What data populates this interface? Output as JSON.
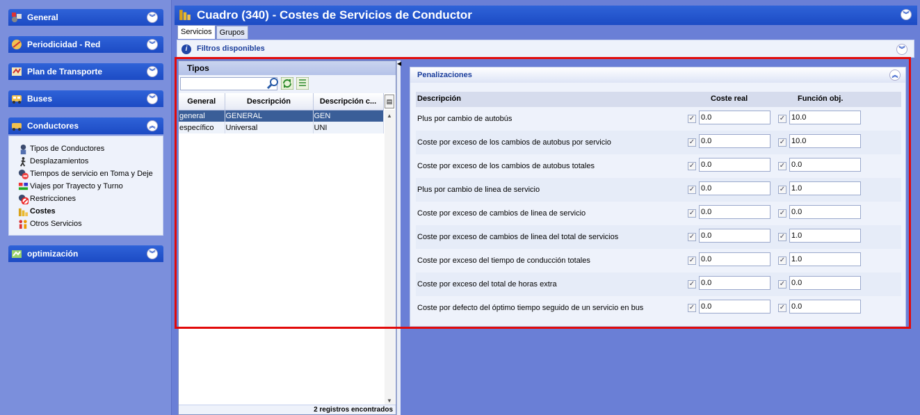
{
  "sidebar": {
    "sections": [
      {
        "label": "General",
        "icon": "general-icon",
        "expanded": false
      },
      {
        "label": "Periodicidad - Red",
        "icon": "periodicidad-icon",
        "expanded": false
      },
      {
        "label": "Plan de Transporte",
        "icon": "plan-icon",
        "expanded": false
      },
      {
        "label": "Buses",
        "icon": "bus-icon",
        "expanded": false
      },
      {
        "label": "Conductores",
        "icon": "conductores-icon",
        "expanded": true
      },
      {
        "label": "optimización",
        "icon": "optimizacion-icon",
        "expanded": false
      }
    ],
    "conductores_items": [
      {
        "label": "Tipos de Conductores",
        "icon": "driver-icon"
      },
      {
        "label": "Desplazamientos",
        "icon": "walk-icon"
      },
      {
        "label": "Tiempos de servicio en Toma y Deje",
        "icon": "clock-icon"
      },
      {
        "label": "Viajes por Trayecto y Turno",
        "icon": "trips-icon"
      },
      {
        "label": "Restricciones",
        "icon": "restriction-icon"
      },
      {
        "label": "Costes",
        "icon": "coins-icon",
        "active": true
      },
      {
        "label": "Otros Servicios",
        "icon": "people-icon"
      }
    ]
  },
  "header": {
    "title": "Cuadro (340) - Costes de Servicios de Conductor"
  },
  "tabs": [
    "Servicios",
    "Grupos"
  ],
  "filters": {
    "label": "Filtros disponibles"
  },
  "tipos": {
    "title": "Tipos",
    "search_value": "",
    "columns": [
      "General",
      "Descripción",
      "Descripción c..."
    ],
    "rows": [
      [
        "general",
        "GENERAL",
        "GEN"
      ],
      [
        "específico",
        "Universal",
        "UNI"
      ]
    ],
    "footer": "2 registros encontrados"
  },
  "penalizaciones": {
    "title": "Penalizaciones",
    "columns": {
      "descripcion": "Descripción",
      "coste_real": "Coste real",
      "funcion_obj": "Función obj."
    },
    "rows": [
      {
        "desc": "Plus por cambio de autobús",
        "coste_real": "0.0",
        "funcion_obj": "10.0"
      },
      {
        "desc": "Coste por exceso de los cambios de autobus por servicio",
        "coste_real": "0.0",
        "funcion_obj": "10.0"
      },
      {
        "desc": "Coste por exceso de los cambios de autobus totales",
        "coste_real": "0.0",
        "funcion_obj": "0.0"
      },
      {
        "desc": "Plus por cambio de linea de servicio",
        "coste_real": "0.0",
        "funcion_obj": "1.0"
      },
      {
        "desc": "Coste por exceso de cambios de linea de servicio",
        "coste_real": "0.0",
        "funcion_obj": "0.0"
      },
      {
        "desc": "Coste por exceso de cambios de linea del total de servicios",
        "coste_real": "0.0",
        "funcion_obj": "1.0"
      },
      {
        "desc": "Coste por exceso del tiempo de conducción totales",
        "coste_real": "0.0",
        "funcion_obj": "1.0"
      },
      {
        "desc": "Coste por exceso del total de horas extra",
        "coste_real": "0.0",
        "funcion_obj": "0.0"
      },
      {
        "desc": "Coste por defecto del óptimo tiempo seguido de un servicio en bus",
        "coste_real": "0.0",
        "funcion_obj": "0.0"
      }
    ]
  },
  "colors": {
    "header_blue": "#1c4bc4",
    "highlight_red": "#e20a0a",
    "selected_row": "#3a5e98"
  }
}
